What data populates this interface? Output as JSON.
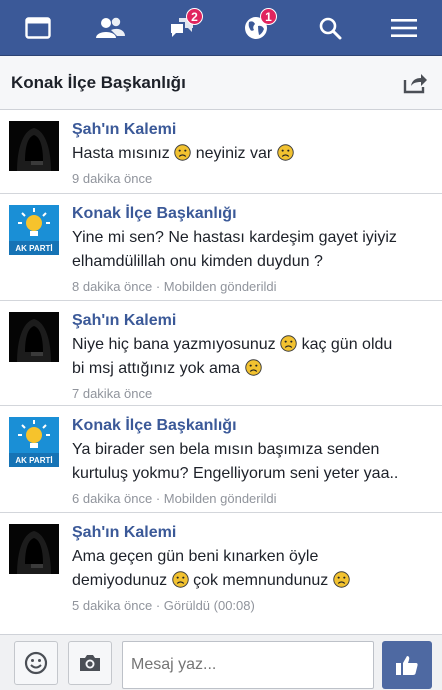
{
  "topbar": {
    "items": [
      {
        "icon": "news-feed-icon"
      },
      {
        "icon": "friend-requests-icon"
      },
      {
        "icon": "messages-icon",
        "badge": "2"
      },
      {
        "icon": "notifications-globe-icon",
        "badge": "1"
      },
      {
        "icon": "search-icon"
      },
      {
        "icon": "menu-icon"
      }
    ],
    "color": "#3b5998"
  },
  "conversation": {
    "title": "Konak İlçe Başkanlığı"
  },
  "messages": [
    {
      "sender": "Şah'ın Kalemi",
      "avatar": "hooded-figure",
      "lines": [
        "Hasta mısınız",
        "neyiniz var"
      ],
      "time": "9 dakika önce"
    },
    {
      "sender": "Konak İlçe Başkanlığı",
      "avatar": "ak-parti-logo",
      "avatar_text": "AK PARTİ",
      "line1": "Yine mi sen? Ne hastası kardeşim gayet iyiyiz",
      "line2": "elhamdülillah onu kimden duydun ?",
      "time": "8 dakika önce · Mobilden gönderildi"
    },
    {
      "sender": "Şah'ın Kalemi",
      "avatar": "hooded-figure",
      "line1a": "Niye hiç bana yazmıyosunuz",
      "line1b": "kaç gün oldu",
      "line2": "bi msj attığınız yok ama",
      "time": "7 dakika önce"
    },
    {
      "sender": "Konak İlçe Başkanlığı",
      "avatar": "ak-parti-logo",
      "avatar_text": "AK PARTİ",
      "line1": "Ya birader sen bela mısın başımıza senden",
      "line2": "kurtuluş yokmu? Engelliyorum seni yeter yaa..",
      "time": "6 dakika önce · Mobilden gönderildi"
    },
    {
      "sender": "Şah'ın Kalemi",
      "avatar": "hooded-figure",
      "line1": "Ama geçen gün beni kınarken öyle",
      "line2a": "demiyodunuz",
      "line2b": "çok memnundunuz",
      "time": "5 dakika önce · Görüldü (00:08)"
    }
  ],
  "composer": {
    "placeholder": "Mesaj yaz..."
  }
}
